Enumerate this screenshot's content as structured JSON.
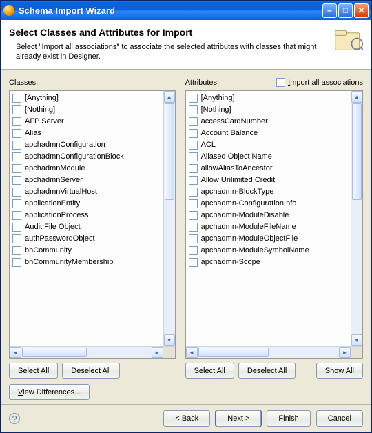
{
  "window": {
    "title": "Schema Import Wizard"
  },
  "header": {
    "title": "Select Classes and Attributes for Import",
    "desc": "Select \"Import all associations\" to associate the selected attributes with classes that might already exist in Designer."
  },
  "labels": {
    "classes": "Classes:",
    "attributes": "Attributes:",
    "import_all": "Import all associations"
  },
  "classes": [
    "[Anything]",
    "[Nothing]",
    "AFP Server",
    "Alias",
    "apchadmnConfiguration",
    "apchadmnConfigurationBlock",
    "apchadmnModule",
    "apchadmnServer",
    "apchadmnVirtualHost",
    "applicationEntity",
    "applicationProcess",
    "Audit:File Object",
    "authPasswordObject",
    "bhCommunity",
    "bhCommunityMembership"
  ],
  "attributes": [
    "[Anything]",
    "[Nothing]",
    "accessCardNumber",
    "Account Balance",
    "ACL",
    "Aliased Object Name",
    "allowAliasToAncestor",
    "Allow Unlimited Credit",
    "apchadmn-BlockType",
    "apchadmn-ConfigurationInfo",
    "apchadmn-ModuleDisable",
    "apchadmn-ModuleFileName",
    "apchadmn-ModuleObjectFile",
    "apchadmn-ModuleSymbolName",
    "apchadmn-Scope"
  ],
  "buttons": {
    "select_all": "Select All",
    "deselect_all": "Deselect All",
    "show_all": "Show All",
    "view_diff": "View Differences...",
    "back": "< Back",
    "next": "Next >",
    "finish": "Finish",
    "cancel": "Cancel"
  }
}
